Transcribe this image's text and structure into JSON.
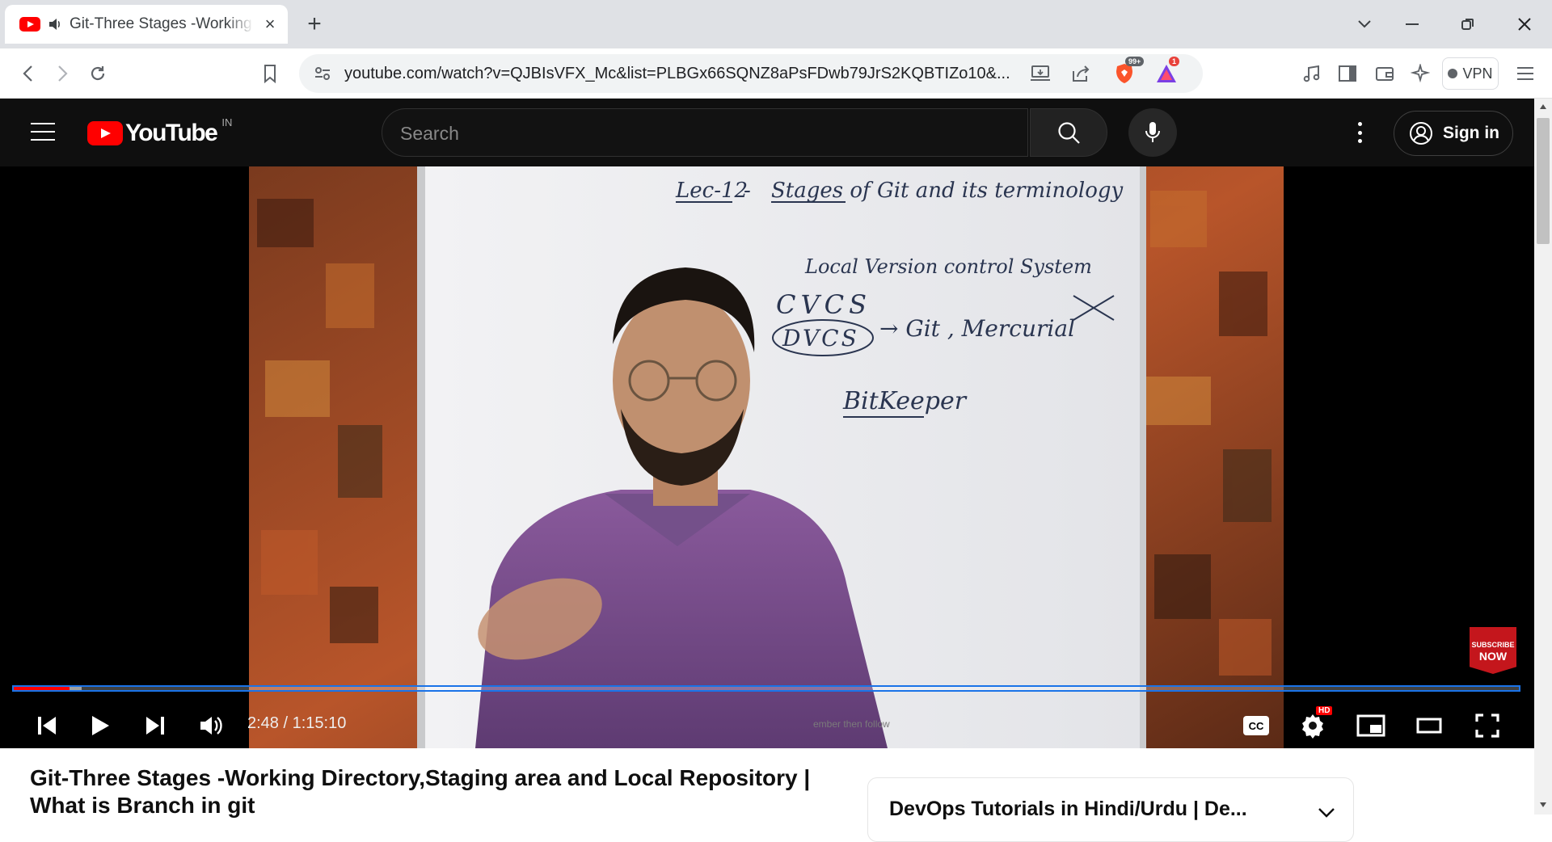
{
  "browser": {
    "tab": {
      "title": "Git-Three Stages -Working Directory,Staging area and Local Repository",
      "audio": "speaker-icon"
    },
    "url": "youtube.com/watch?v=QJBIsVFX_Mc&list=PLBGx66SQNZ8aPsFDwb79JrS2KQBTIZo10&...",
    "brave_badge": "99+",
    "rewards_badge": "1",
    "vpn_label": "VPN",
    "colors": {
      "tab_strip": "#dfe1e5",
      "omnibox": "#f1f3f4"
    }
  },
  "youtube": {
    "logo_text": "YouTube",
    "country_code": "IN",
    "search_placeholder": "Search",
    "sign_in_label": "Sign in",
    "colors": {
      "masthead": "#0f0f0f",
      "brand_red": "#ff0000"
    }
  },
  "player": {
    "time_display": "2:48 / 1:15:10",
    "current_time": "2:48",
    "duration": "1:15:10",
    "progress_fraction": 0.037,
    "buffered_fraction": 0.045,
    "hd_badge": "HD",
    "subscribe_overlay": {
      "line1": "SUBSCRIBE",
      "line2": "NOW"
    },
    "whiteboard": {
      "heading_lec": "Lec-12",
      "heading_dash": "-",
      "heading_rest": "Stages of Git and its terminology",
      "line1": "Local Version control System",
      "cvcs": "CVCS",
      "dvcs": "DVCS",
      "dvcs_tools": "→ Git , Mercurial",
      "bitkeeper": "BitKeeper"
    },
    "lower_caption": "ember then follow"
  },
  "video": {
    "title": "Git-Three Stages -Working Directory,Staging area and Local Repository | What is Branch in git"
  },
  "playlist": {
    "title": "DevOps Tutorials in Hindi/Urdu | De..."
  }
}
